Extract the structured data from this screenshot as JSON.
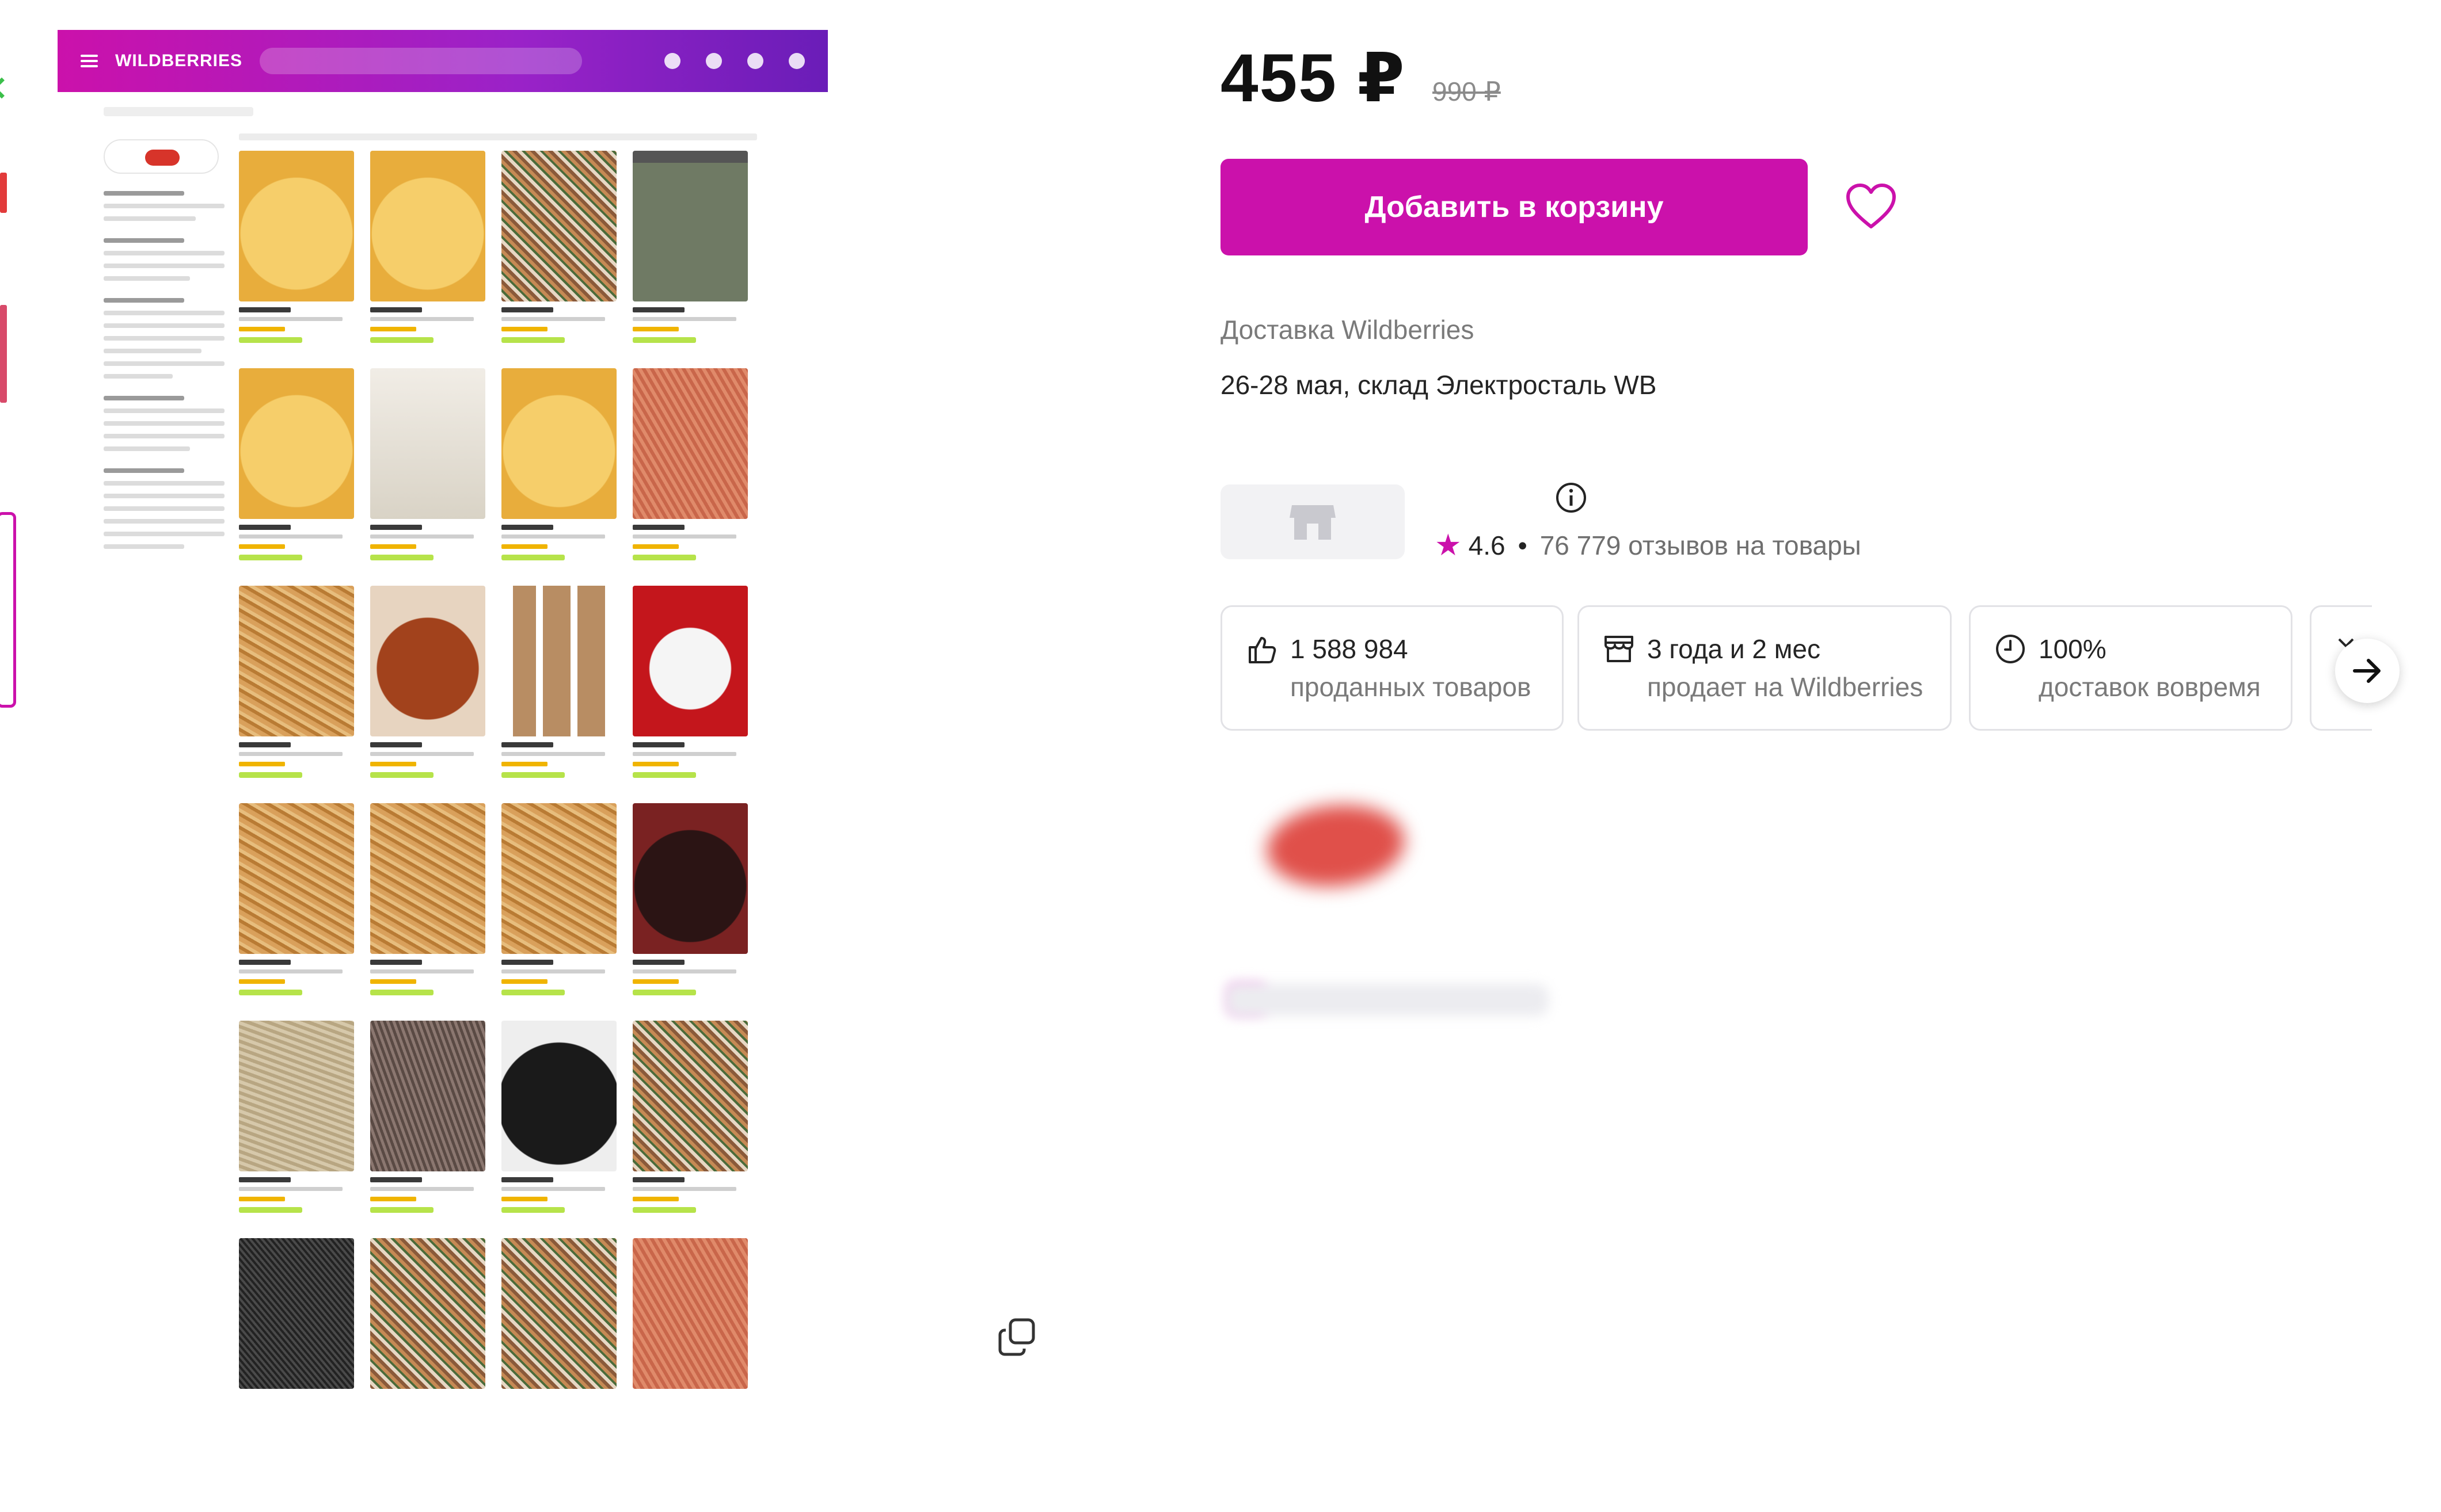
{
  "product": {
    "price": "455 ₽",
    "old_price": "990 ₽",
    "add_to_cart_label": "Добавить в корзину",
    "delivery_title": "Доставка Wildberries",
    "delivery_dates": "26-28 мая, склад Электросталь WB"
  },
  "seller": {
    "rating": "4.6",
    "separator": "•",
    "reviews": "76 779 отзывов на товары",
    "stats": [
      {
        "icon": "thumbs-up-icon",
        "value": "1 588 984",
        "caption": "проданных товаров"
      },
      {
        "icon": "store-icon",
        "value": "3 года и 2 мес",
        "caption": "продает на Wildberries"
      },
      {
        "icon": "clock-icon",
        "value": "100%",
        "caption": "доставок вовремя"
      }
    ]
  },
  "embedded_screenshot": {
    "logo_text": "WILDBERRIES"
  },
  "colors": {
    "accent": "#cb11ab",
    "header_gradient_end": "#6a1db8",
    "text": "#242424",
    "muted": "#7a7a7a"
  },
  "icons": [
    "menu-icon",
    "copy-icon",
    "heart-icon",
    "store-placeholder-icon",
    "info-icon",
    "star-icon",
    "thumbs-up-icon",
    "store-icon",
    "clock-icon",
    "arrow-right-icon",
    "chevron-down-icon"
  ]
}
